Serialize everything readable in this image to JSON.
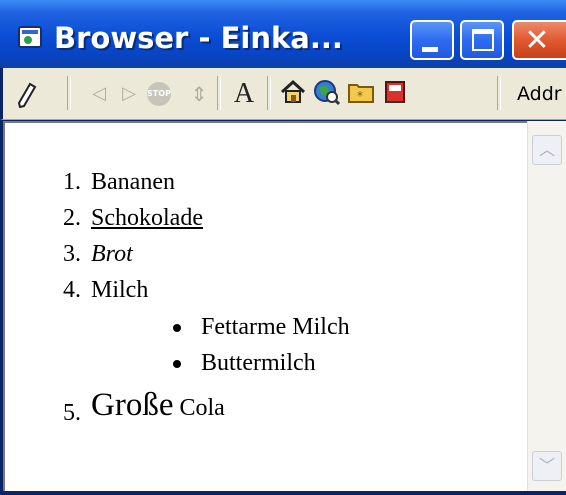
{
  "window": {
    "title": "Browser - Einka..."
  },
  "toolbar": {
    "address_label": "Addr",
    "icons": [
      "pencil-icon",
      "back-icon",
      "forward-icon",
      "stop-icon",
      "refresh-icon",
      "font-size-icon",
      "home-icon",
      "search-globe-icon",
      "favorites-folder-icon",
      "history-book-icon"
    ],
    "stop_label": "STOP",
    "font_label": "A"
  },
  "list": {
    "items": [
      {
        "number": "1.",
        "text": "Bananen"
      },
      {
        "number": "2.",
        "text": "Schokolade"
      },
      {
        "number": "3.",
        "text": "Brot"
      },
      {
        "number": "4.",
        "text": "Milch",
        "subitems": [
          "Fettarme Milch",
          "Buttermilch"
        ]
      },
      {
        "number": "5.",
        "text_big": "Große",
        "text_rest": " Cola"
      }
    ]
  },
  "colors": {
    "titlebar": "#0a4cd4",
    "close_button": "#e05a30",
    "toolbar_bg": "#ece9d8",
    "content_bg": "#ffffff"
  }
}
